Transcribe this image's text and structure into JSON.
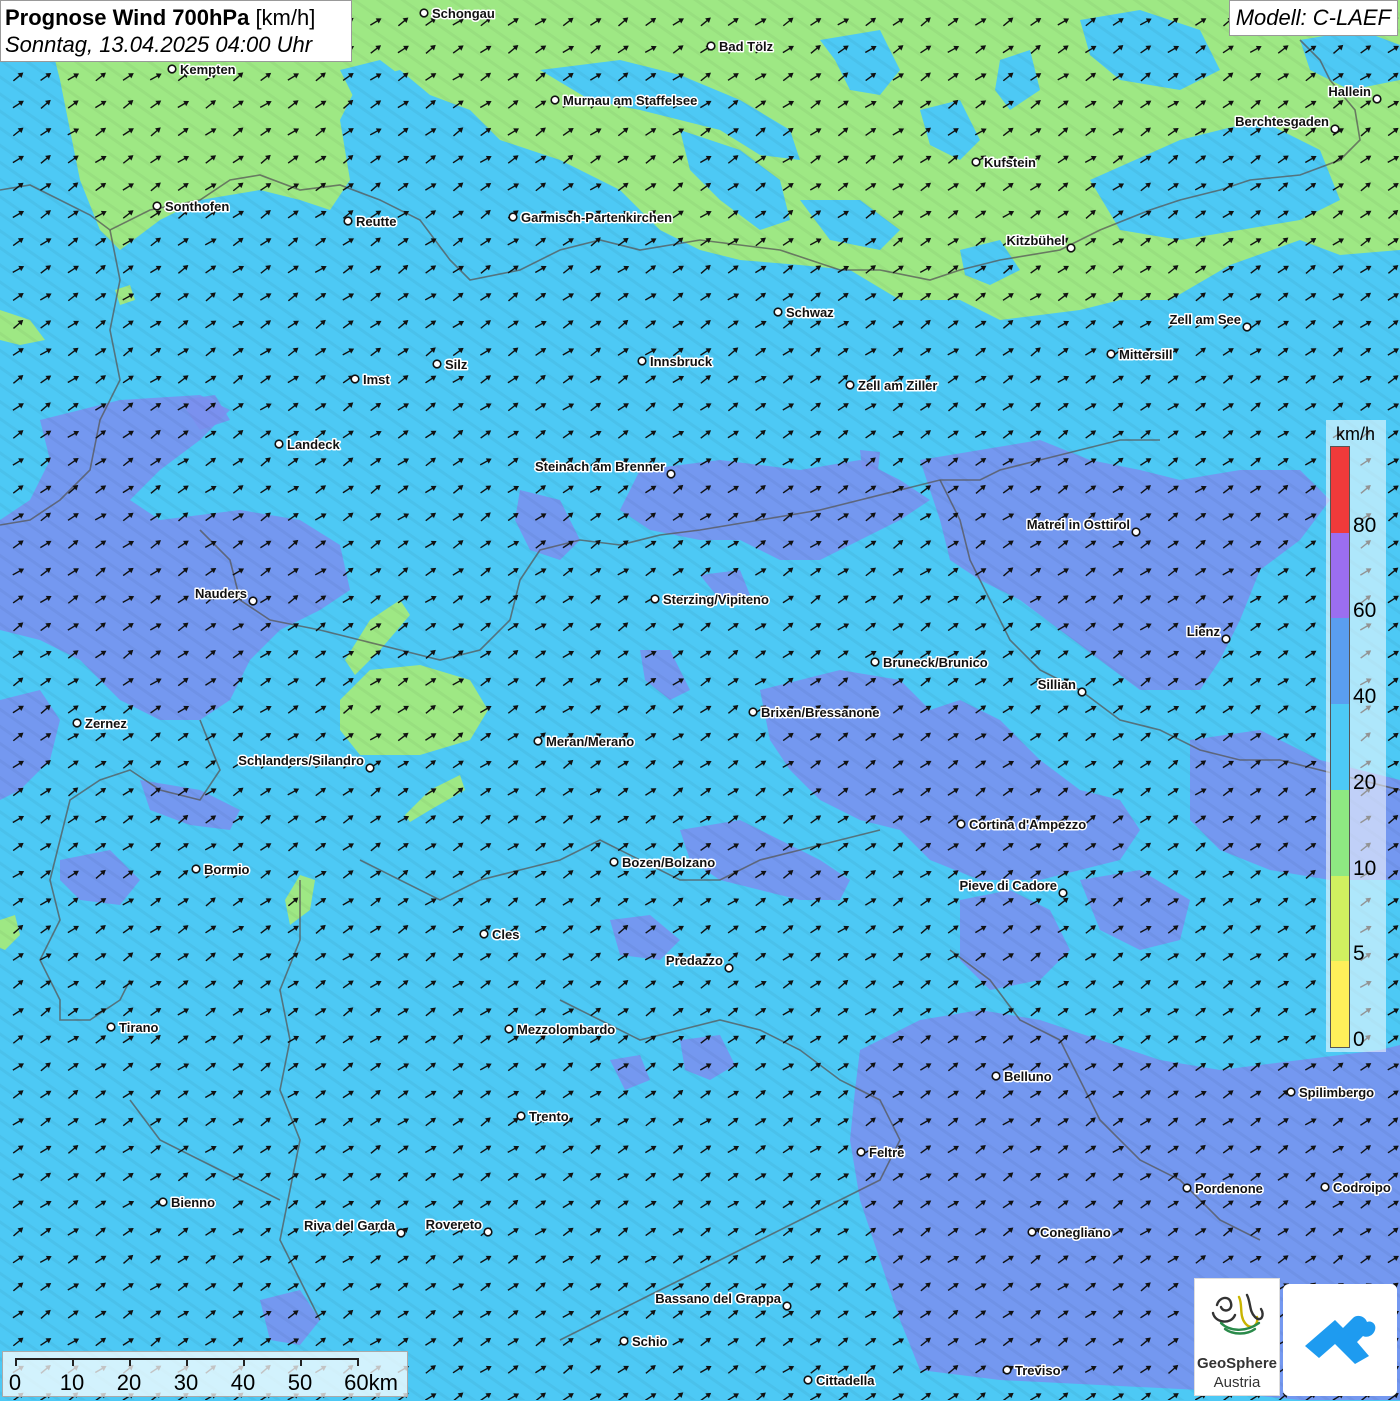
{
  "title": {
    "main": "Prognose Wind 700hPa",
    "unit": "[km/h]",
    "datetime": "Sonntag, 13.04.2025 04:00 Uhr"
  },
  "model": "Modell: C-LAEF",
  "legend": {
    "unit": "km/h",
    "ticks": [
      "0",
      "5",
      "10",
      "20",
      "40",
      "60",
      "80"
    ],
    "colors": [
      "#ffef5a",
      "#d0f060",
      "#8ee882",
      "#4dc9f5",
      "#5a9ef0",
      "#9b6ef0",
      "#f03a3a"
    ]
  },
  "scale_bar": {
    "labels": [
      "0",
      "10",
      "20",
      "30",
      "40",
      "50",
      "60km"
    ]
  },
  "wind": {
    "direction": "southwest to northeast"
  },
  "cities": [
    {
      "name": "Schongau"
    },
    {
      "name": "Bad Tölz"
    },
    {
      "name": "Kempten"
    },
    {
      "name": "Murnau am Staffelsee"
    },
    {
      "name": "Hallein"
    },
    {
      "name": "Berchtesgaden"
    },
    {
      "name": "Kufstein"
    },
    {
      "name": "Sonthofen"
    },
    {
      "name": "Reutte"
    },
    {
      "name": "Garmisch-Partenkirchen"
    },
    {
      "name": "Kitzbühel"
    },
    {
      "name": "Schwaz"
    },
    {
      "name": "Zell am See"
    },
    {
      "name": "Mittersill"
    },
    {
      "name": "Innsbruck"
    },
    {
      "name": "Silz"
    },
    {
      "name": "Imst"
    },
    {
      "name": "Zell am Ziller"
    },
    {
      "name": "Landeck"
    },
    {
      "name": "Steinach am Brenner"
    },
    {
      "name": "Matrei in Osttirol"
    },
    {
      "name": "Nauders"
    },
    {
      "name": "Sterzing/Vipiteno"
    },
    {
      "name": "Lienz"
    },
    {
      "name": "Bruneck/Brunico"
    },
    {
      "name": "Sillian"
    },
    {
      "name": "Brixen/Bressanone"
    },
    {
      "name": "Zernez"
    },
    {
      "name": "Meran/Merano"
    },
    {
      "name": "Schlanders/Silandro"
    },
    {
      "name": "Cortina d'Ampezzo"
    },
    {
      "name": "Bozen/Bolzano"
    },
    {
      "name": "Bormio"
    },
    {
      "name": "Pieve di Cadore"
    },
    {
      "name": "Cles"
    },
    {
      "name": "Predazzo"
    },
    {
      "name": "Tirano"
    },
    {
      "name": "Mezzolombardo"
    },
    {
      "name": "Belluno"
    },
    {
      "name": "Spilimbergo"
    },
    {
      "name": "Trento"
    },
    {
      "name": "Feltre"
    },
    {
      "name": "Pordenone"
    },
    {
      "name": "Codroipo"
    },
    {
      "name": "Bienno"
    },
    {
      "name": "Riva del Garda"
    },
    {
      "name": "Rovereto"
    },
    {
      "name": "Conegliano"
    },
    {
      "name": "Bassano del Grappa"
    },
    {
      "name": "Schio"
    },
    {
      "name": "Treviso"
    },
    {
      "name": "Cittadella"
    }
  ],
  "logos": {
    "geosphere_line1": "GeoSphere",
    "geosphere_line2": "Austria"
  }
}
